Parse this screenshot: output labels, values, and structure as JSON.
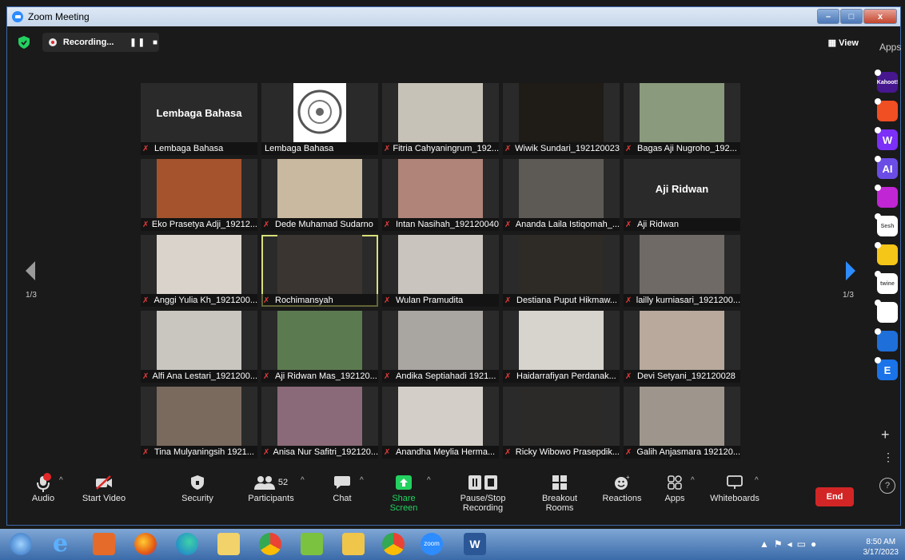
{
  "window": {
    "title": "Zoom Meeting"
  },
  "topbar": {
    "recording_label": "Recording...",
    "view_label": "View"
  },
  "apps_label": "Apps",
  "pagination": {
    "left": "1/3",
    "right": "1/3"
  },
  "tiles": [
    {
      "name": "Lembaga Bahasa",
      "big": "Lembaga Bahasa",
      "muted": true,
      "bg": "#262626"
    },
    {
      "name": "Lembaga Bahasa",
      "big": "",
      "muted": false,
      "bg": "#ffffff",
      "logo": true
    },
    {
      "name": "Fitria Cahyaningrum_192...",
      "big": "",
      "muted": true,
      "bg": "#c7c2b8"
    },
    {
      "name": "Wiwik Sundari_192120023",
      "big": "",
      "muted": true,
      "bg": "#1f1c18"
    },
    {
      "name": "Bagas Aji Nugroho_192...",
      "big": "",
      "muted": true,
      "bg": "#8a9a7c"
    },
    {
      "name": "Eko Prasetya Adji_19212...",
      "big": "",
      "muted": true,
      "bg": "#a5532d"
    },
    {
      "name": "Dede Muhamad Sudarno",
      "big": "",
      "muted": true,
      "bg": "#c9b9a0"
    },
    {
      "name": "Intan Nasihah_192120040",
      "big": "",
      "muted": true,
      "bg": "#b08478"
    },
    {
      "name": "Ananda Laila Istiqomah_...",
      "big": "",
      "muted": true,
      "bg": "#5d5a55"
    },
    {
      "name": "Aji Ridwan",
      "big": "Aji Ridwan",
      "muted": true,
      "bg": "#262626"
    },
    {
      "name": "Anggi Yulia Kh_1921200...",
      "big": "",
      "muted": true,
      "bg": "#d9d3cb"
    },
    {
      "name": "Rochimansyah",
      "big": "",
      "muted": true,
      "bg": "#3a3530",
      "active": true
    },
    {
      "name": "Wulan Pramudita",
      "big": "",
      "muted": true,
      "bg": "#c9c4bd"
    },
    {
      "name": "Destiana Puput Hikmaw...",
      "big": "",
      "muted": true,
      "bg": "#2e2a25"
    },
    {
      "name": "lailly kurniasari_1921200...",
      "big": "",
      "muted": true,
      "bg": "#6f6a66"
    },
    {
      "name": "Alfi Ana Lestari_1921200...",
      "big": "",
      "muted": true,
      "bg": "#c8c6bf"
    },
    {
      "name": "Aji Ridwan Mas_192120...",
      "big": "",
      "muted": true,
      "bg": "#5c7a4f"
    },
    {
      "name": "Andika Septiahadi 1921...",
      "big": "",
      "muted": true,
      "bg": "#a9a6a2"
    },
    {
      "name": "Haidarrafiyan Perdanak...",
      "big": "",
      "muted": true,
      "bg": "#d7d3cd"
    },
    {
      "name": "Devi Setyani_192120028",
      "big": "",
      "muted": true,
      "bg": "#b8a99c"
    },
    {
      "name": "Tina Mulyaningsih 1921...",
      "big": "",
      "muted": true,
      "bg": "#7a6a5e"
    },
    {
      "name": "Anisa Nur Safitri_192120...",
      "big": "",
      "muted": true,
      "bg": "#8a6a78"
    },
    {
      "name": "Anandha Meylia Herma...",
      "big": "",
      "muted": true,
      "bg": "#d3cfc8"
    },
    {
      "name": "Ricky Wibowo Prasepdik...",
      "big": "",
      "muted": true,
      "bg": "#2b2a28"
    },
    {
      "name": "Galih Anjasmara 192120...",
      "big": "",
      "muted": true,
      "bg": "#9e968c"
    }
  ],
  "toolbar": {
    "audio": "Audio",
    "start_video": "Start Video",
    "security": "Security",
    "participants": "Participants",
    "participants_count": "52",
    "chat": "Chat",
    "share_screen": "Share Screen",
    "pause_stop_recording": "Pause/Stop Recording",
    "breakout_rooms": "Breakout Rooms",
    "reactions": "Reactions",
    "apps": "Apps",
    "whiteboards": "Whiteboards",
    "end": "End"
  },
  "side_apps": [
    {
      "label": "Kahoot!",
      "color": "#46178f"
    },
    {
      "label": "",
      "color": "#f04e23"
    },
    {
      "label": "W",
      "color": "#7b2ff7"
    },
    {
      "label": "AI",
      "color": "#6b4de6"
    },
    {
      "label": "",
      "color": "#c026d3"
    },
    {
      "label": "Sesh",
      "color": "#ffffff"
    },
    {
      "label": "",
      "color": "#f5c518"
    },
    {
      "label": "twine",
      "color": "#ffffff"
    },
    {
      "label": "",
      "color": "#ffffff"
    },
    {
      "label": "",
      "color": "#1e6fd9"
    },
    {
      "label": "E",
      "color": "#1a73e8"
    }
  ],
  "taskbar": {
    "time": "8:50 AM",
    "date": "3/17/2023"
  }
}
